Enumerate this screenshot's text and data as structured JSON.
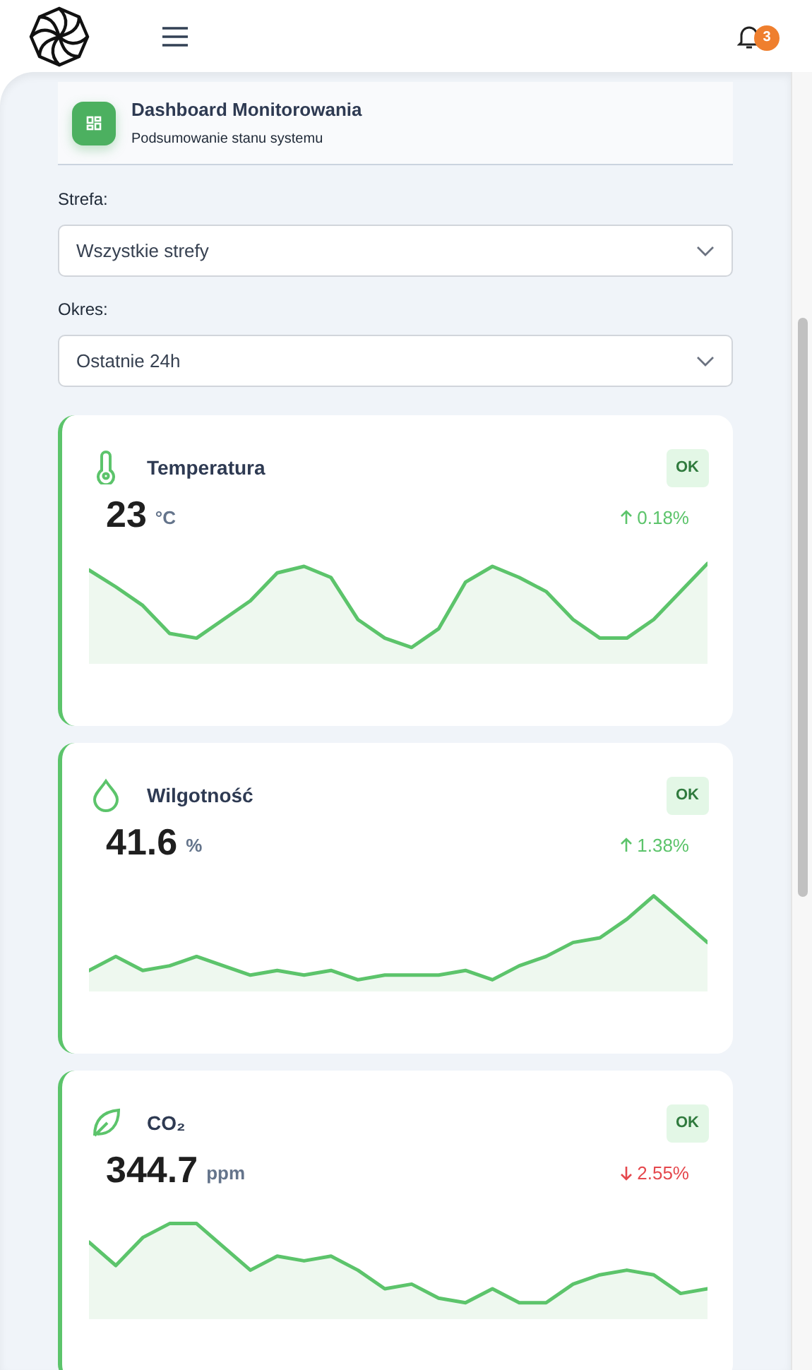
{
  "header": {
    "notification_count": "3"
  },
  "page_header": {
    "title": "Dashboard Monitorowania",
    "subtitle": "Podsumowanie stanu systemu"
  },
  "filters": [
    {
      "label": "Strefa:",
      "value": "Wszystkie strefy"
    },
    {
      "label": "Okres:",
      "value": "Ostatnie 24h"
    }
  ],
  "metrics": [
    {
      "kind": "temperature",
      "name": "Temperatura",
      "status": "OK",
      "value": "23",
      "unit": "°C",
      "rising": true,
      "change": "0.18%"
    },
    {
      "kind": "humidity",
      "name": "Wilgotność",
      "status": "OK",
      "value": "41.6",
      "unit": "%",
      "rising": true,
      "change": "1.38%"
    },
    {
      "kind": "co2",
      "name": "CO₂",
      "status": "OK",
      "value": "344.7",
      "unit": "ppm",
      "rising": false,
      "change": "2.55%"
    }
  ]
}
